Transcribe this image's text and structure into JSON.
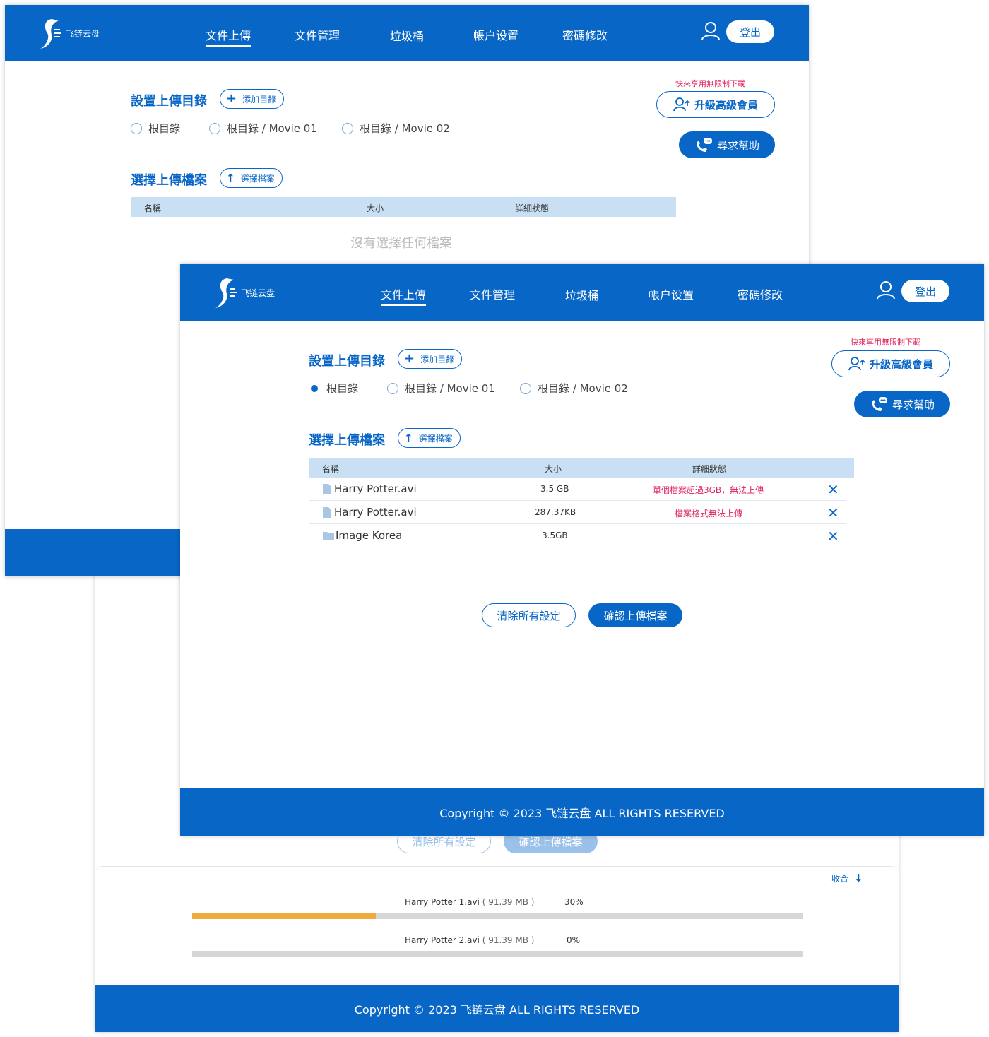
{
  "brand": {
    "name": "飞链云盘"
  },
  "nav": {
    "upload": "文件上傳",
    "manage": "文件管理",
    "trash": "垃圾桶",
    "account": "帳户设置",
    "password": "密碼修改"
  },
  "header": {
    "logout": "登出"
  },
  "sidebar": {
    "promo": "快來享用無限制下載",
    "upgrade": "升級高級會員",
    "help": "尋求幫助"
  },
  "directory": {
    "title": "設置上傳目錄",
    "add_button": "添加目錄",
    "options": [
      "根目錄",
      "根目錄 / Movie 01",
      "根目錄 / Movie 02"
    ],
    "selected_in_front": 0
  },
  "files": {
    "title": "選擇上傳檔案",
    "select_button": "選擇檔案",
    "columns": {
      "name": "名稱",
      "size": "大小",
      "status": "詳細狀態"
    },
    "empty_message": "沒有選擇任何檔案",
    "rows": [
      {
        "name": "Harry Potter.avi",
        "size": "3.5 GB",
        "status": "單個檔案超過3GB，無法上傳",
        "icon": "file-icon"
      },
      {
        "name": "Harry Potter.avi",
        "size": "287.37KB",
        "status": "檔案格式無法上傳",
        "icon": "file-icon"
      },
      {
        "name": "Image Korea",
        "size": "3.5GB",
        "status": "",
        "icon": "folder-icon"
      }
    ]
  },
  "actions": {
    "clear": "清除所有設定",
    "confirm": "確認上傳檔案"
  },
  "footer": {
    "copyright": "Copyright © 2023 飞链云盘 ALL RIGHTS RESERVED"
  },
  "progress_panel": {
    "collapse": "收合",
    "items": [
      {
        "name": "Harry Potter 1.avi",
        "size": "( 91.39 MB )",
        "percent_label": "30%",
        "fraction": 0.3
      },
      {
        "name": "Harry Potter 2.avi",
        "size": "( 91.39 MB )",
        "percent_label": "0%",
        "fraction": 0.0
      }
    ]
  },
  "colors": {
    "primary": "#0866c6",
    "table_head": "#c9dff3",
    "error": "#e0245e",
    "progress": "#f0a93b"
  }
}
